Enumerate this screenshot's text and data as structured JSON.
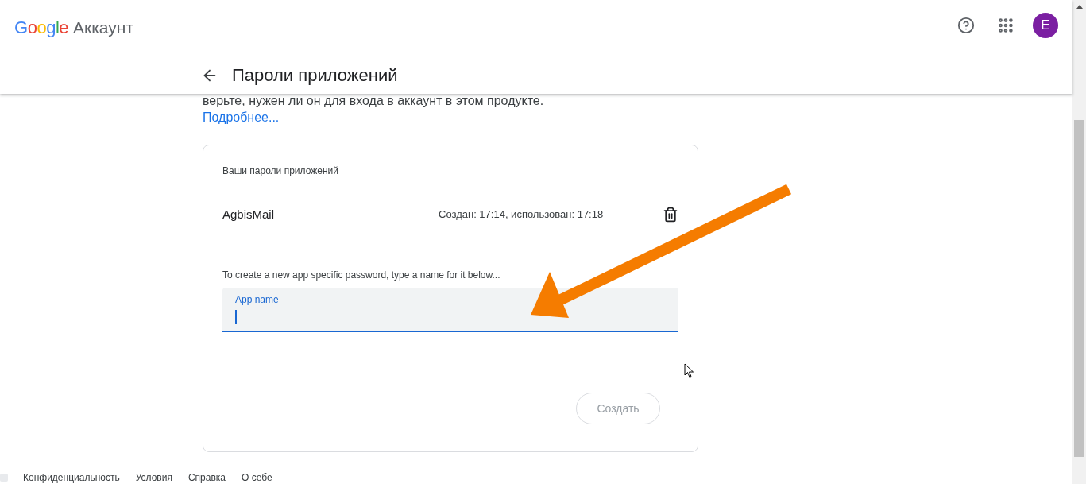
{
  "header": {
    "logo": "Google",
    "product": "Аккаунт",
    "page_title": "Пароли приложений",
    "avatar": "E"
  },
  "intro": {
    "paragraph_lines": [
      "верьте, нужен ли он для входа в аккаунт в этом продукте."
    ],
    "link": "Подробнее..."
  },
  "card": {
    "heading": "Ваши пароли приложений",
    "passwords": [
      {
        "name": "AgbisMail",
        "info": "Создан: 17:14, использован: 17:18"
      }
    ],
    "instruction": "To create a new app specific password, type a name for it below...",
    "field": {
      "label": "App name",
      "focused": true
    },
    "button": {
      "label": "Создать",
      "disabled": true
    }
  },
  "footer": {
    "links": [
      "Конфиденциальность",
      "Условия",
      "Справка",
      "О себе"
    ]
  }
}
